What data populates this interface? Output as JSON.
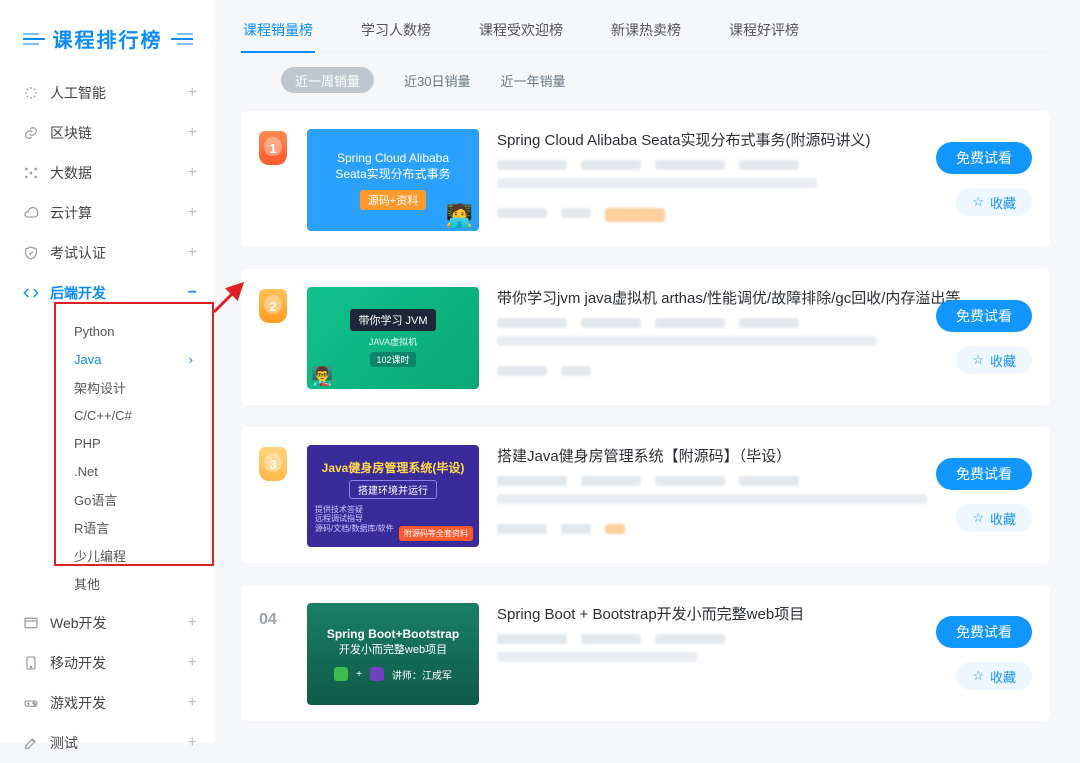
{
  "sidebar": {
    "title": "课程排行榜",
    "categories": [
      {
        "id": "ai",
        "label": "人工智能",
        "icon": "sparkle-icon"
      },
      {
        "id": "blockchain",
        "label": "区块链",
        "icon": "link-icon"
      },
      {
        "id": "bigdata",
        "label": "大数据",
        "icon": "nodes-icon"
      },
      {
        "id": "cloud",
        "label": "云计算",
        "icon": "cloud-icon"
      },
      {
        "id": "exam",
        "label": "考试认证",
        "icon": "shield-check-icon"
      },
      {
        "id": "backend",
        "label": "后端开发",
        "icon": "code-icon",
        "expanded": true,
        "children": [
          {
            "label": "Python"
          },
          {
            "label": "Java",
            "selected": true
          },
          {
            "label": "架构设计"
          },
          {
            "label": "C/C++/C#"
          },
          {
            "label": "PHP"
          },
          {
            "label": ".Net"
          },
          {
            "label": "Go语言"
          },
          {
            "label": "R语言"
          },
          {
            "label": "少儿编程"
          },
          {
            "label": "其他"
          }
        ]
      },
      {
        "id": "web",
        "label": "Web开发",
        "icon": "window-icon"
      },
      {
        "id": "mobile",
        "label": "移动开发",
        "icon": "tablet-icon"
      },
      {
        "id": "game",
        "label": "游戏开发",
        "icon": "gamepad-icon"
      },
      {
        "id": "test",
        "label": "测试",
        "icon": "edit-icon"
      }
    ],
    "expand_glyph": "+",
    "collapse_glyph": "−"
  },
  "tabs": {
    "items": [
      {
        "label": "课程销量榜",
        "active": true
      },
      {
        "label": "学习人数榜"
      },
      {
        "label": "课程受欢迎榜"
      },
      {
        "label": "新课热卖榜"
      },
      {
        "label": "课程好评榜"
      }
    ]
  },
  "subtabs": {
    "items": [
      {
        "label": "近一周销量",
        "active": true
      },
      {
        "label": "近30日销量"
      },
      {
        "label": "近一年销量"
      }
    ]
  },
  "actions": {
    "trial": "免费试看",
    "fav": "收藏"
  },
  "courses": [
    {
      "rank": "1",
      "title": "Spring Cloud Alibaba Seata实现分布式事务(附源码讲义)",
      "thumb": {
        "style": "t1",
        "line1": "Spring Cloud Alibaba",
        "line2": "Seata实现分布式事务",
        "tag": "源码+资料"
      }
    },
    {
      "rank": "2",
      "title": "带你学习jvm java虚拟机 arthas/性能调优/故障排除/gc回收/内存溢出等",
      "thumb": {
        "style": "t2",
        "title": "带你学习 JVM",
        "sub": "JAVA虚拟机",
        "pill": "102课时"
      }
    },
    {
      "rank": "3",
      "title": "搭建Java健身房管理系统【附源码】（毕设）",
      "thumb": {
        "style": "t3",
        "line1": "Java健身房管理系统(毕设)",
        "line2": "搭建环境并运行",
        "foot": "提供技术答疑\n远程调试指导\n源码/文档/数据库/软件",
        "badge": "附源码等全套资料"
      }
    },
    {
      "rank": "04",
      "title": "Spring Boot + Bootstrap开发小而完整web项目",
      "thumb": {
        "style": "t4",
        "l1": "Spring Boot+Bootstrap",
        "l2": "开发小而完整web项目",
        "teacher": "讲师：江成军"
      }
    }
  ]
}
